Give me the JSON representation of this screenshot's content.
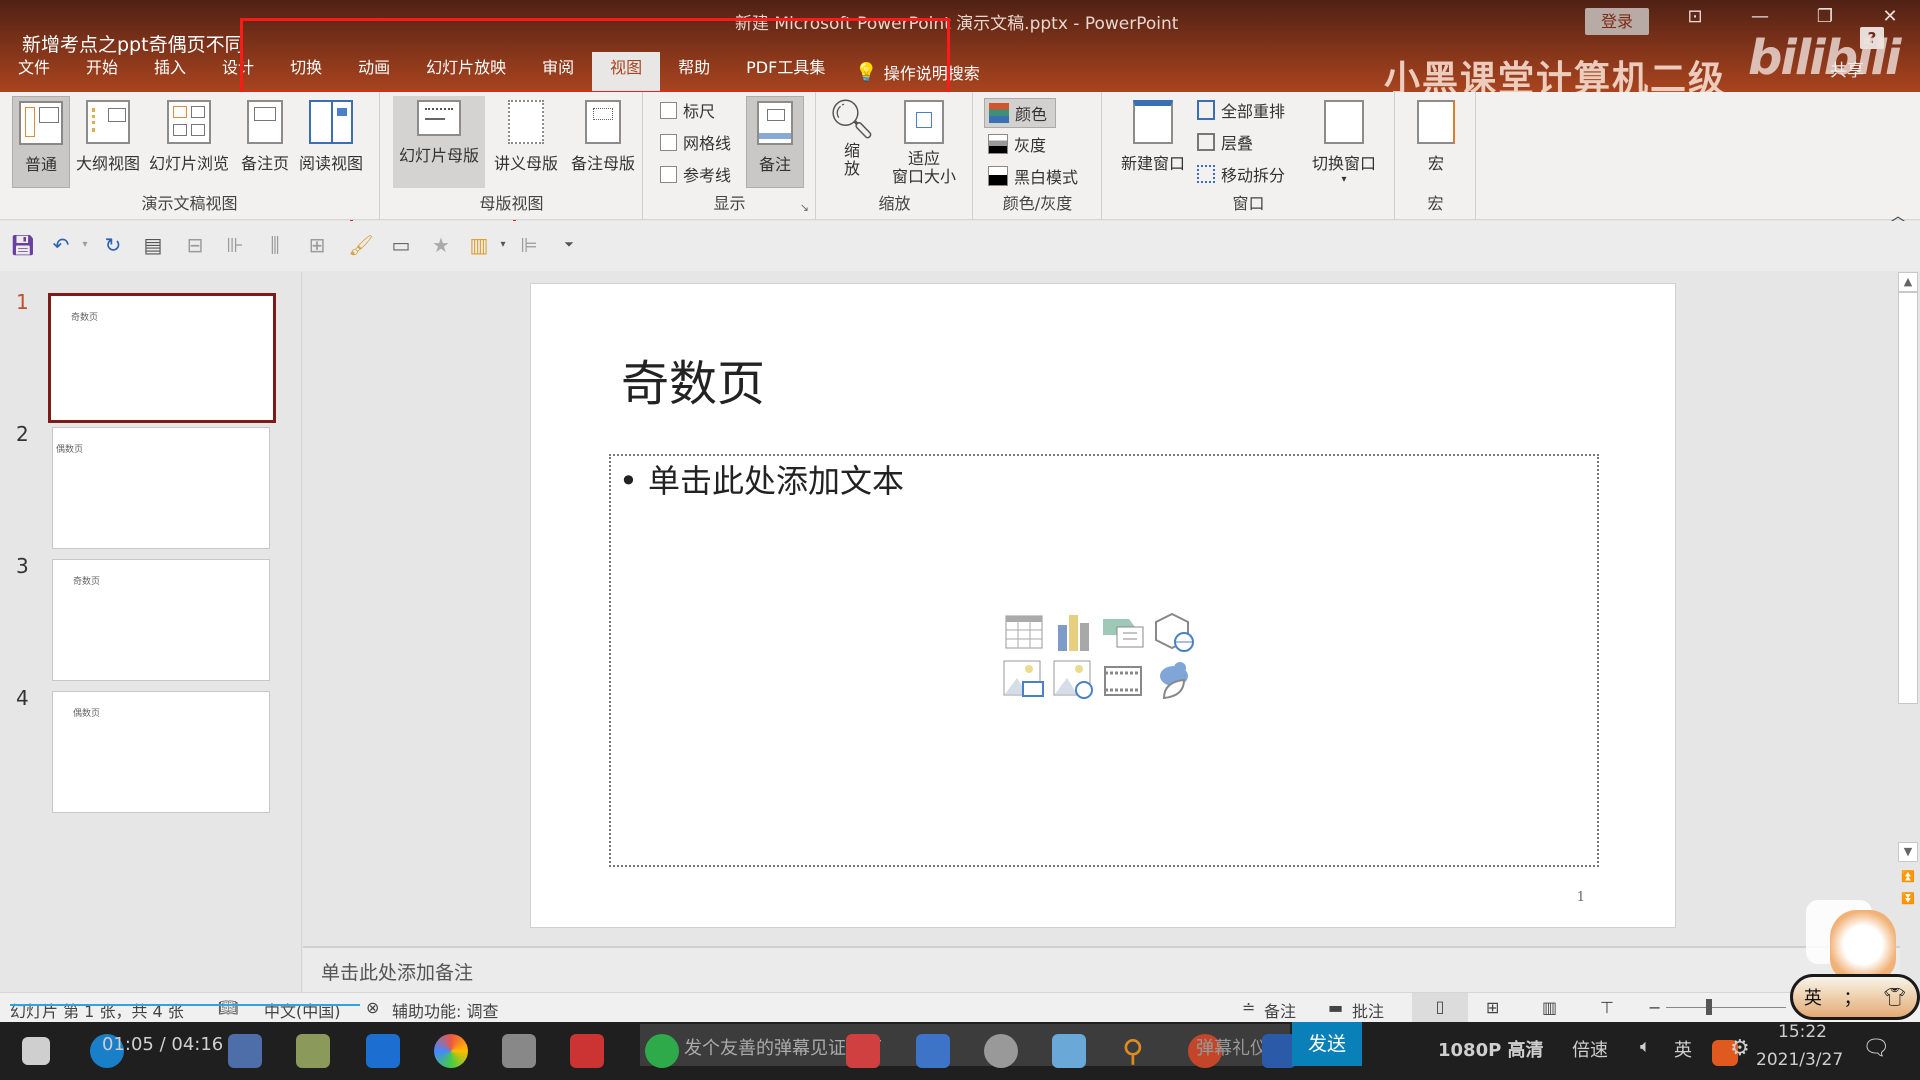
{
  "window": {
    "video_title": "新增考点之ppt奇偶页不同",
    "title": "新建 Microsoft PowerPoint 演示文稿.pptx  -  PowerPoint",
    "login_label": "登录",
    "watermark": "小黑课堂计算机二级",
    "bilibili": "bilibili",
    "share_label": "共享",
    "help_label": "?"
  },
  "tabs": [
    {
      "label": "文件"
    },
    {
      "label": "开始"
    },
    {
      "label": "插入"
    },
    {
      "label": "设计"
    },
    {
      "label": "切换"
    },
    {
      "label": "动画"
    },
    {
      "label": "幻灯片放映"
    },
    {
      "label": "审阅"
    },
    {
      "label": "视图",
      "active": true
    },
    {
      "label": "帮助"
    },
    {
      "label": "PDF工具集"
    }
  ],
  "tell_me": "操作说明搜索",
  "ribbon": {
    "presentation_views": {
      "label": "演示文稿视图",
      "buttons": [
        "普通",
        "大纲视图",
        "幻灯片浏览",
        "备注页",
        "阅读视图"
      ]
    },
    "master_views": {
      "label": "母版视图",
      "buttons": [
        "幻灯片母版",
        "讲义母版",
        "备注母版"
      ]
    },
    "show": {
      "label": "显示",
      "checkboxes": [
        {
          "label": "标尺",
          "checked": false
        },
        {
          "label": "网格线",
          "checked": false
        },
        {
          "label": "参考线",
          "checked": false
        }
      ],
      "notes_button": "备注"
    },
    "zoom": {
      "label": "缩放",
      "zoom_button": "缩\n放",
      "fit_button_line1": "适应",
      "fit_button_line2": "窗口大小"
    },
    "color": {
      "label": "颜色/灰度",
      "options": [
        "颜色",
        "灰度",
        "黑白模式"
      ]
    },
    "window": {
      "label": "窗口",
      "new_window": "新建窗口",
      "arrange_all": "全部重排",
      "cascade": "层叠",
      "move_split": "移动拆分",
      "switch_windows": "切换窗口"
    },
    "macros": {
      "label": "宏",
      "button": "宏"
    }
  },
  "slides": [
    {
      "number": "1",
      "title": "奇数页",
      "active": true
    },
    {
      "number": "2",
      "title": "偶数页"
    },
    {
      "number": "3",
      "title": "奇数页"
    },
    {
      "number": "4",
      "title": "偶数页"
    }
  ],
  "current_slide": {
    "title": "奇数页",
    "content_placeholder": "• 单击此处添加文本",
    "page_number": "1"
  },
  "notes_placeholder": "单击此处添加备注",
  "statusbar": {
    "slide_info": "幻灯片 第 1 张，共 4 张",
    "language": "中文(中国)",
    "accessibility": "辅助功能: 调查",
    "notes_label": "备注",
    "comments_label": "批注"
  },
  "player": {
    "time": "01:05 / 04:16",
    "danmaku_placeholder": "发个友善的弹幕见证当下",
    "danmaku_etiquette": "弹幕礼仪",
    "send_label": "发送",
    "quality": "1080P 高清",
    "speed": "倍速"
  },
  "taskbar": {
    "clock_time": "15:22",
    "clock_date": "2021/3/27",
    "ime": "英"
  },
  "colors": {
    "accent": "#a9441f",
    "title_gradient_top": "#4f2115",
    "active_slide_border": "#7d1a1a",
    "highlight_box": "#ff1a1a"
  }
}
